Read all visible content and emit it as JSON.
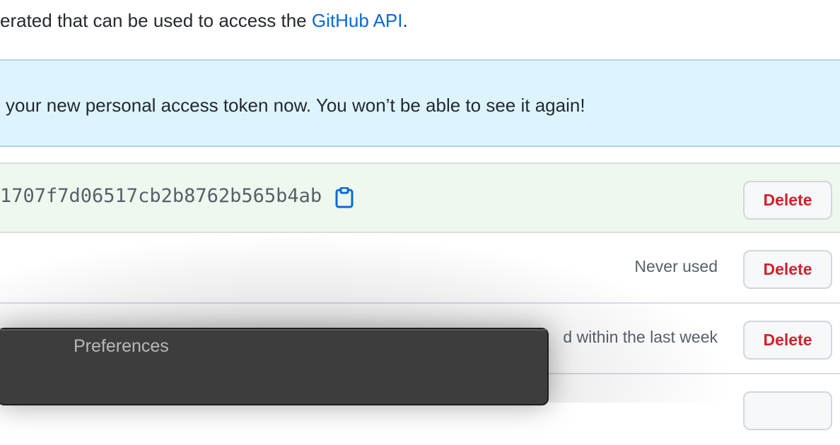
{
  "intro": {
    "text_before": "erated that can be used to access the ",
    "link_text": "GitHub API",
    "text_after": "."
  },
  "flash": {
    "message": " your new personal access token now. You won’t be able to see it again!"
  },
  "tokens": [
    {
      "value": "1707f7d06517cb2b8762b565b4ab",
      "status": "",
      "delete_label": "Delete"
    },
    {
      "value": "",
      "status": "Never used",
      "delete_label": "Delete"
    },
    {
      "value": "",
      "status": "d within the last week",
      "delete_label": "Delete"
    },
    {
      "value": "",
      "status": "",
      "delete_label": ""
    }
  ],
  "preferences_window": {
    "title": "Preferences"
  },
  "colors": {
    "link": "#0969da",
    "danger": "#cf222e",
    "flash_bg": "#ddf4ff",
    "new_token_bg": "#eef8ee",
    "window_bg": "#3d3d3d"
  },
  "icons": {
    "copy": "clipboard-icon"
  }
}
